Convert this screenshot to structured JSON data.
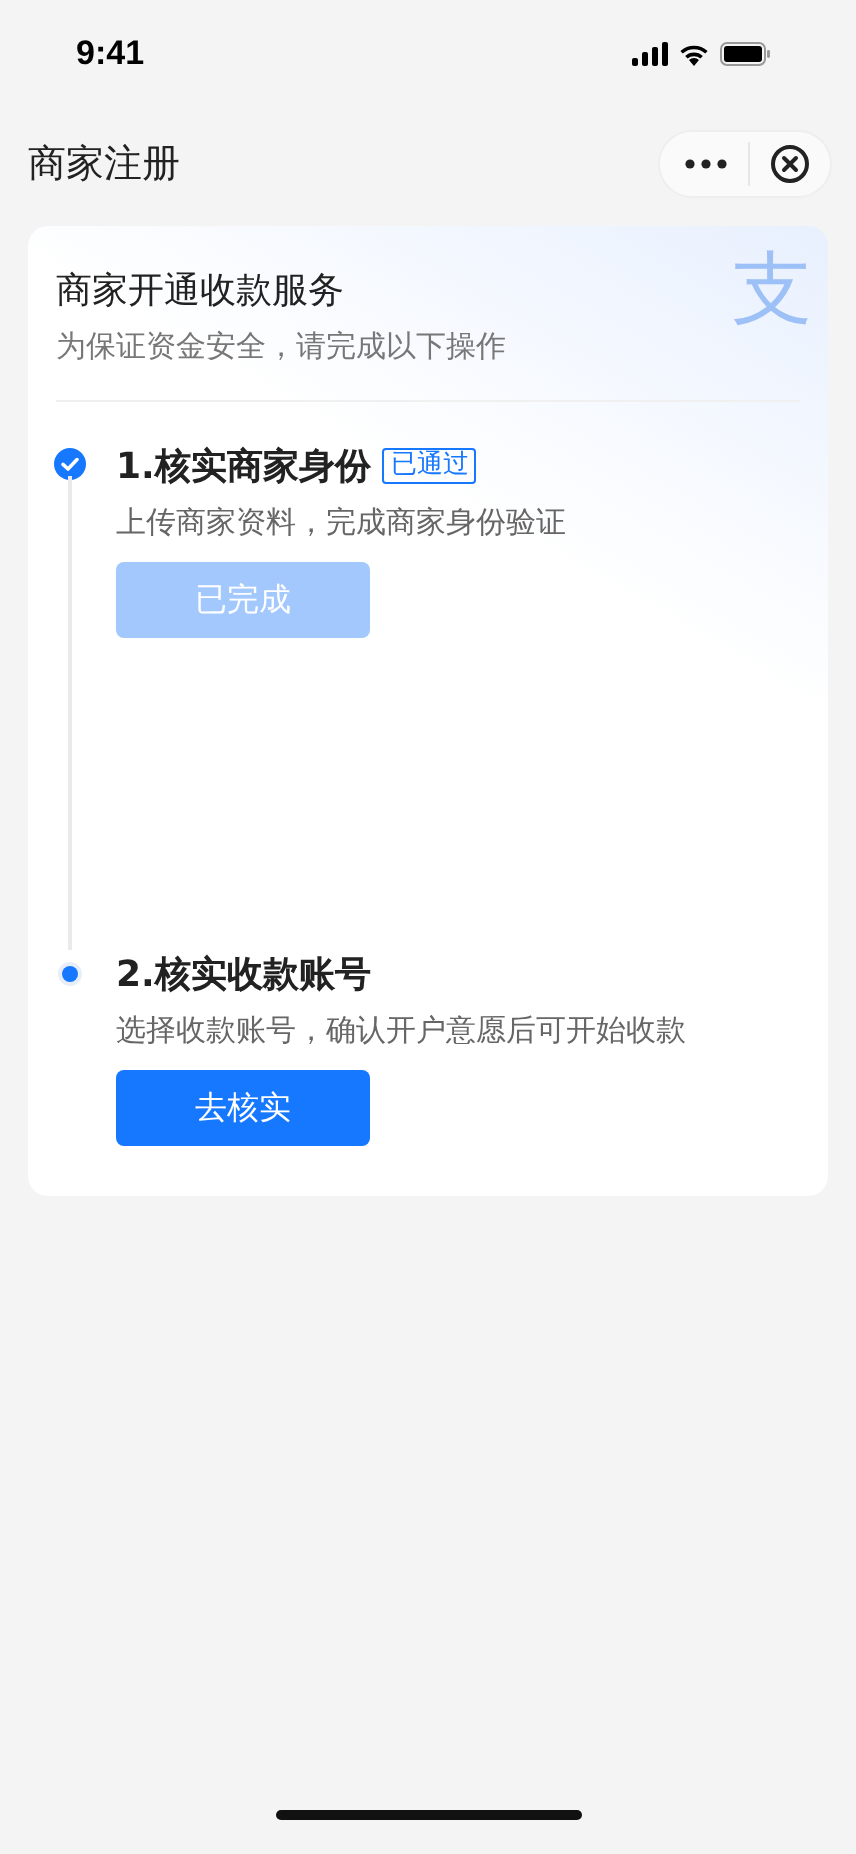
{
  "status_bar": {
    "time": "9:41"
  },
  "nav": {
    "title": "商家注册"
  },
  "card": {
    "title": "商家开通收款服务",
    "subtitle": "为保证资金安全，请完成以下操作",
    "logo_glyph": "支"
  },
  "steps": [
    {
      "title": "1.核实商家身份",
      "badge": "已通过",
      "description": "上传商家资料，完成商家身份验证",
      "button": "已完成",
      "completed": true,
      "disabled": true
    },
    {
      "title": "2.核实收款账号",
      "description": "选择收款账号，确认开户意愿后可开始收款",
      "button": "去核实",
      "completed": false,
      "disabled": false
    }
  ]
}
